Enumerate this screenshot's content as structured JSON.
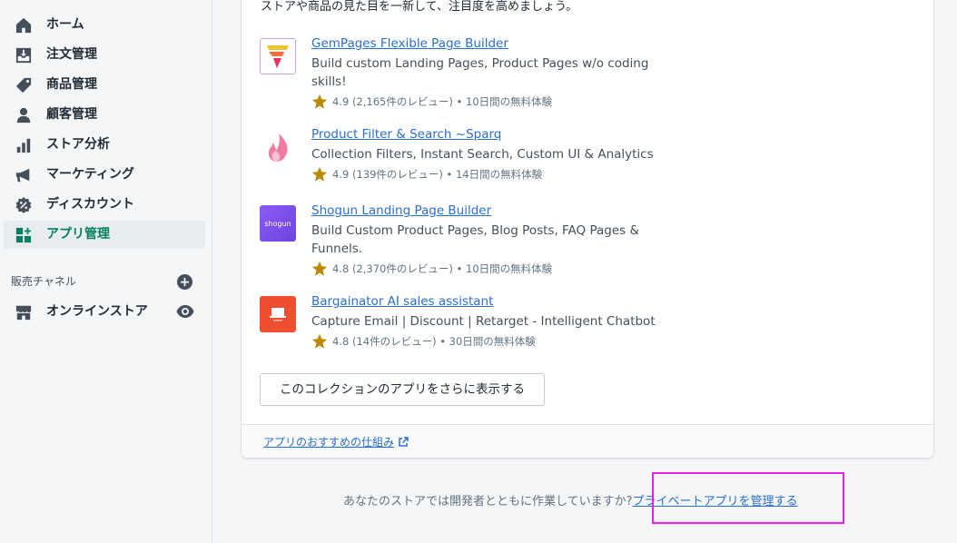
{
  "sidebar": {
    "items": [
      {
        "label": "ホーム",
        "icon": "home-icon"
      },
      {
        "label": "注文管理",
        "icon": "orders-icon"
      },
      {
        "label": "商品管理",
        "icon": "tag-icon"
      },
      {
        "label": "顧客管理",
        "icon": "person-icon"
      },
      {
        "label": "ストア分析",
        "icon": "bar-chart-icon"
      },
      {
        "label": "マーケティング",
        "icon": "megaphone-icon"
      },
      {
        "label": "ディスカウント",
        "icon": "discount-icon"
      },
      {
        "label": "アプリ管理",
        "icon": "apps-icon",
        "active": true
      }
    ],
    "channels_title": "販売チャネル",
    "add_channel_symbol": "+",
    "channels": [
      {
        "label": "オンラインストア",
        "icon": "store-icon"
      }
    ]
  },
  "card": {
    "intro": "ストアや商品の見た目を一新して、注目度を高めましょう。",
    "apps": [
      {
        "name": "GemPages Flexible Page Builder",
        "description": "Build custom Landing Pages, Product Pages w/o coding skills!",
        "rating": "4.9",
        "reviews": "(2,165件のレビュー)",
        "trial": "• 10日間の無料体験"
      },
      {
        "name": "Product Filter & Search ~Sparq",
        "description": "Collection Filters, Instant Search, Custom UI & Analytics",
        "rating": "4.9",
        "reviews": "(139件のレビュー)",
        "trial": "• 14日間の無料体験"
      },
      {
        "name": "Shogun Landing Page Builder",
        "description": "Build Custom Product Pages, Blog Posts, FAQ Pages & Funnels.",
        "rating": "4.8",
        "reviews": "(2,370件のレビュー)",
        "trial": "• 10日間の無料体験",
        "logo_text": "shogun"
      },
      {
        "name": "Bargainator AI sales assistant",
        "description": "Capture Email | Discount | Retarget - Intelligent Chatbot",
        "rating": "4.8",
        "reviews": "(14件のレビュー)",
        "trial": "• 30日間の無料体験"
      }
    ],
    "more_button": "このコレクションのアプリをさらに表示する",
    "footer_link": "アプリのおすすめの仕組み"
  },
  "bottom": {
    "question": "あなたのストアでは開発者とともに作業していますか?",
    "link": "プライベートアプリを管理する"
  },
  "colors": {
    "accent": "#008060",
    "link": "#2c6ecb",
    "highlight": "#e91ee9",
    "star": "#b98900"
  }
}
